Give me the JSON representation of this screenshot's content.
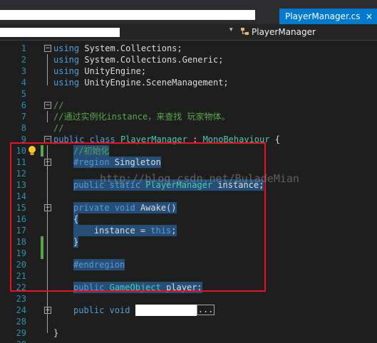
{
  "tab": {
    "title": "PlayerManager.cs",
    "close": "×"
  },
  "nav": {
    "class_name": "PlayerManager",
    "dropdown_arrow": "▾"
  },
  "lines": [
    {
      "n": "1",
      "s": [
        [
          "kw",
          "using"
        ],
        [
          "id",
          " System.Collections;"
        ]
      ]
    },
    {
      "n": "2",
      "s": [
        [
          "kw",
          "using"
        ],
        [
          "id",
          " System.Collections.Generic;"
        ]
      ]
    },
    {
      "n": "3",
      "s": [
        [
          "kw",
          "using"
        ],
        [
          "id",
          " UnityEngine;"
        ]
      ]
    },
    {
      "n": "4",
      "s": [
        [
          "kw",
          "using"
        ],
        [
          "id",
          " UnityEngine.SceneManagement;"
        ]
      ]
    },
    {
      "n": "5",
      "s": []
    },
    {
      "n": "6",
      "s": [
        [
          "cm",
          "//"
        ]
      ]
    },
    {
      "n": "7",
      "s": [
        [
          "cm",
          "//通过实例化instance，来查找 玩家物体。"
        ]
      ]
    },
    {
      "n": "8",
      "s": [
        [
          "cm",
          "//"
        ]
      ]
    },
    {
      "n": "9",
      "s": [
        [
          "kw",
          "public"
        ],
        [
          "id",
          " "
        ],
        [
          "kw",
          "class"
        ],
        [
          "id",
          " "
        ],
        [
          "ty",
          "PlayerManager"
        ],
        [
          "id",
          " : "
        ],
        [
          "ty",
          "MonoBehaviour"
        ],
        [
          "id",
          " {"
        ]
      ]
    },
    {
      "n": "10",
      "sel": true,
      "s": [
        [
          "cm2",
          "//初始化"
        ]
      ]
    },
    {
      "n": "11",
      "sel": true,
      "s": [
        [
          "kw",
          "#region"
        ],
        [
          "id",
          " Singleton"
        ]
      ]
    },
    {
      "n": "12",
      "s": []
    },
    {
      "n": "13",
      "sel": true,
      "s": [
        [
          "kw",
          "public"
        ],
        [
          "id",
          " "
        ],
        [
          "kw",
          "static"
        ],
        [
          "id",
          " "
        ],
        [
          "ty",
          "PlayerManager"
        ],
        [
          "id",
          " instance;"
        ]
      ]
    },
    {
      "n": "14",
      "s": []
    },
    {
      "n": "15",
      "sel": true,
      "s": [
        [
          "kw",
          "private"
        ],
        [
          "id",
          " "
        ],
        [
          "kw",
          "void"
        ],
        [
          "id",
          " Awake()"
        ]
      ]
    },
    {
      "n": "16",
      "sel": true,
      "s": [
        [
          "id",
          "{"
        ]
      ]
    },
    {
      "n": "17",
      "sel": true,
      "s": [
        [
          "id",
          "    instance = "
        ],
        [
          "kw",
          "this"
        ],
        [
          "id",
          ";"
        ]
      ]
    },
    {
      "n": "18",
      "sel": true,
      "s": [
        [
          "id",
          "}"
        ]
      ]
    },
    {
      "n": "19",
      "s": []
    },
    {
      "n": "20",
      "sel": true,
      "s": [
        [
          "kw",
          "#endregion"
        ]
      ]
    },
    {
      "n": "21",
      "s": []
    },
    {
      "n": "22",
      "sel": true,
      "s": [
        [
          "kw",
          "public"
        ],
        [
          "id",
          " "
        ],
        [
          "ty",
          "GameObject"
        ],
        [
          "id",
          " player;"
        ]
      ]
    },
    {
      "n": "23",
      "s": []
    },
    {
      "n": "24",
      "s": [
        [
          "kw",
          "public"
        ],
        [
          "id",
          " "
        ],
        [
          "kw",
          "void"
        ],
        [
          "id",
          " "
        ]
      ],
      "collapsed": true
    },
    {
      "n": "28",
      "s": []
    },
    {
      "n": "29",
      "s": [
        [
          "id",
          "}"
        ]
      ]
    },
    {
      "n": "30",
      "s": []
    }
  ],
  "ellipsis": "...",
  "watermark": "http://blog.csdn.net/BuladeMian",
  "colors": {
    "accent": "#007acc",
    "keyword": "#569cd6",
    "type": "#4ec9b0",
    "comment": "#57a64a",
    "highlight_box": "#e81123",
    "selection": "#264f78",
    "line_number": "#2b91af"
  }
}
